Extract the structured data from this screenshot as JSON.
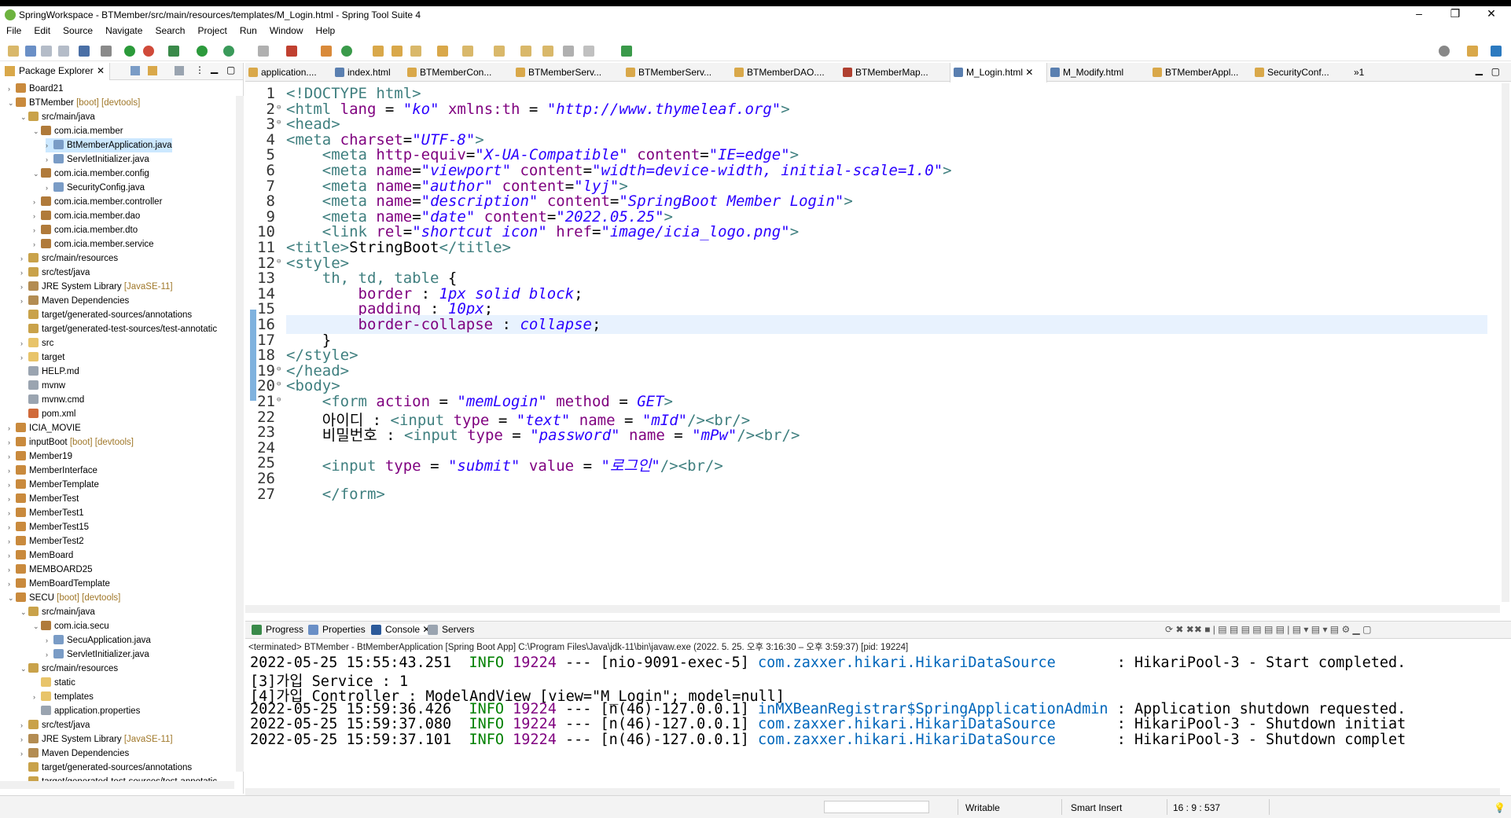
{
  "window": {
    "title": "SpringWorkspace - BTMember/src/main/resources/templates/M_Login.html - Spring Tool Suite 4",
    "minimize": "–",
    "maximize": "❐",
    "close": "✕"
  },
  "menu": [
    "File",
    "Edit",
    "Source",
    "Navigate",
    "Search",
    "Project",
    "Run",
    "Window",
    "Help"
  ],
  "package_explorer": {
    "title": "Package Explorer",
    "tree": [
      {
        "label": "Board21",
        "icon": "project",
        "indent": 0,
        "twisty": ">"
      },
      {
        "label": "BTMember",
        "deco": "[boot] [devtools]",
        "icon": "project",
        "indent": 0,
        "twisty": "v"
      },
      {
        "label": "src/main/java",
        "icon": "srcfolder",
        "indent": 1,
        "twisty": "v"
      },
      {
        "label": "com.icia.member",
        "icon": "package",
        "indent": 2,
        "twisty": "v"
      },
      {
        "label": "BtMemberApplication.java",
        "icon": "javafile",
        "indent": 3,
        "twisty": ">",
        "selected": true
      },
      {
        "label": "ServletInitializer.java",
        "icon": "javafile",
        "indent": 3,
        "twisty": ">"
      },
      {
        "label": "com.icia.member.config",
        "icon": "package",
        "indent": 2,
        "twisty": "v"
      },
      {
        "label": "SecurityConfig.java",
        "icon": "javafile",
        "indent": 3,
        "twisty": ">"
      },
      {
        "label": "com.icia.member.controller",
        "icon": "package",
        "indent": 2,
        "twisty": ">"
      },
      {
        "label": "com.icia.member.dao",
        "icon": "package",
        "indent": 2,
        "twisty": ">"
      },
      {
        "label": "com.icia.member.dto",
        "icon": "package",
        "indent": 2,
        "twisty": ">"
      },
      {
        "label": "com.icia.member.service",
        "icon": "package",
        "indent": 2,
        "twisty": ">"
      },
      {
        "label": "src/main/resources",
        "icon": "srcfolder",
        "indent": 1,
        "twisty": ">"
      },
      {
        "label": "src/test/java",
        "icon": "srcfolder",
        "indent": 1,
        "twisty": ">"
      },
      {
        "label": "JRE System Library",
        "deco": "[JavaSE-11]",
        "icon": "library",
        "indent": 1,
        "twisty": ">"
      },
      {
        "label": "Maven Dependencies",
        "icon": "library",
        "indent": 1,
        "twisty": ">"
      },
      {
        "label": "target/generated-sources/annotations",
        "icon": "srcfolder",
        "indent": 1,
        "twisty": ""
      },
      {
        "label": "target/generated-test-sources/test-annotatic",
        "icon": "srcfolder",
        "indent": 1,
        "twisty": ""
      },
      {
        "label": "src",
        "icon": "folder",
        "indent": 1,
        "twisty": ">"
      },
      {
        "label": "target",
        "icon": "folder",
        "indent": 1,
        "twisty": ">"
      },
      {
        "label": "HELP.md",
        "icon": "file",
        "indent": 1,
        "twisty": ""
      },
      {
        "label": "mvnw",
        "icon": "file",
        "indent": 1,
        "twisty": ""
      },
      {
        "label": "mvnw.cmd",
        "icon": "file",
        "indent": 1,
        "twisty": ""
      },
      {
        "label": "pom.xml",
        "icon": "xmlfile",
        "indent": 1,
        "twisty": ""
      },
      {
        "label": "ICIA_MOVIE",
        "icon": "project",
        "indent": 0,
        "twisty": ">"
      },
      {
        "label": "inputBoot",
        "deco": "[boot] [devtools]",
        "icon": "project",
        "indent": 0,
        "twisty": ">"
      },
      {
        "label": "Member19",
        "icon": "project",
        "indent": 0,
        "twisty": ">"
      },
      {
        "label": "MemberInterface",
        "icon": "project",
        "indent": 0,
        "twisty": ">"
      },
      {
        "label": "MemberTemplate",
        "icon": "project",
        "indent": 0,
        "twisty": ">"
      },
      {
        "label": "MemberTest",
        "icon": "project",
        "indent": 0,
        "twisty": ">"
      },
      {
        "label": "MemberTest1",
        "icon": "project",
        "indent": 0,
        "twisty": ">"
      },
      {
        "label": "MemberTest15",
        "icon": "project",
        "indent": 0,
        "twisty": ">"
      },
      {
        "label": "MemberTest2",
        "icon": "project",
        "indent": 0,
        "twisty": ">"
      },
      {
        "label": "MemBoard",
        "icon": "project",
        "indent": 0,
        "twisty": ">"
      },
      {
        "label": "MEMBOARD25",
        "icon": "project",
        "indent": 0,
        "twisty": ">"
      },
      {
        "label": "MemBoardTemplate",
        "icon": "project",
        "indent": 0,
        "twisty": ">"
      },
      {
        "label": "SECU",
        "deco": "[boot] [devtools]",
        "icon": "project",
        "indent": 0,
        "twisty": "v"
      },
      {
        "label": "src/main/java",
        "icon": "srcfolder",
        "indent": 1,
        "twisty": "v"
      },
      {
        "label": "com.icia.secu",
        "icon": "package",
        "indent": 2,
        "twisty": "v"
      },
      {
        "label": "SecuApplication.java",
        "icon": "javafile",
        "indent": 3,
        "twisty": ">"
      },
      {
        "label": "ServletInitializer.java",
        "icon": "javafile",
        "indent": 3,
        "twisty": ">"
      },
      {
        "label": "src/main/resources",
        "icon": "srcfolder",
        "indent": 1,
        "twisty": "v"
      },
      {
        "label": "static",
        "icon": "folder",
        "indent": 2,
        "twisty": ""
      },
      {
        "label": "templates",
        "icon": "folder",
        "indent": 2,
        "twisty": ">"
      },
      {
        "label": "application.properties",
        "icon": "file",
        "indent": 2,
        "twisty": ""
      },
      {
        "label": "src/test/java",
        "icon": "srcfolder",
        "indent": 1,
        "twisty": ">"
      },
      {
        "label": "JRE System Library",
        "deco": "[JavaSE-11]",
        "icon": "library",
        "indent": 1,
        "twisty": ">"
      },
      {
        "label": "Maven Dependencies",
        "icon": "library",
        "indent": 1,
        "twisty": ">"
      },
      {
        "label": "target/generated-sources/annotations",
        "icon": "srcfolder",
        "indent": 1,
        "twisty": ""
      },
      {
        "label": "target/generated-test-sources/test-annotatic",
        "icon": "srcfolder",
        "indent": 1,
        "twisty": ""
      }
    ]
  },
  "editor_tabs": [
    {
      "label": "application....",
      "icon": "properties"
    },
    {
      "label": "index.html",
      "icon": "html"
    },
    {
      "label": "BTMemberCon...",
      "icon": "java"
    },
    {
      "label": "BTMemberServ...",
      "icon": "java"
    },
    {
      "label": "BTMemberServ...",
      "icon": "java"
    },
    {
      "label": "BTMemberDAO....",
      "icon": "java"
    },
    {
      "label": "BTMemberMap...",
      "icon": "xml"
    },
    {
      "label": "M_Login.html",
      "icon": "html",
      "active": true
    },
    {
      "label": "M_Modify.html",
      "icon": "html"
    },
    {
      "label": "BTMemberAppl...",
      "icon": "java"
    },
    {
      "label": "SecurityConf...",
      "icon": "java"
    },
    {
      "label": "»1",
      "icon": ""
    }
  ],
  "code_lines": [
    {
      "n": "1",
      "html": "<span class='tg'>&lt;!DOCTYPE html&gt;</span>"
    },
    {
      "n": "2",
      "fold": "⊖",
      "html": "<span class='tg'>&lt;html</span> <span class='at'>lang</span> = <span class='av'>\"ko\"</span> <span class='at'>xmlns:th</span> = <span class='av'>\"http://www.thymeleaf.org\"</span><span class='tg'>&gt;</span>"
    },
    {
      "n": "3",
      "fold": "⊖",
      "html": "<span class='tg'>&lt;head&gt;</span>"
    },
    {
      "n": "4",
      "html": "<span class='tg'>&lt;meta</span> <span class='at'>charset</span>=<span class='av'>\"UTF-8\"</span><span class='tg'>&gt;</span>"
    },
    {
      "n": "5",
      "html": "    <span class='tg'>&lt;meta</span> <span class='at'>http-equiv</span>=<span class='av'>\"X-UA-Compatible\"</span> <span class='at'>content</span>=<span class='av'>\"IE=edge\"</span><span class='tg'>&gt;</span>"
    },
    {
      "n": "6",
      "html": "    <span class='tg'>&lt;meta</span> <span class='at'>name</span>=<span class='av'>\"viewport\"</span> <span class='at'>content</span>=<span class='av'>\"width=device-width, initial-scale=1.0\"</span><span class='tg'>&gt;</span>"
    },
    {
      "n": "7",
      "html": "    <span class='tg'>&lt;meta</span> <span class='at'>name</span>=<span class='av'>\"author\"</span> <span class='at'>content</span>=<span class='av'>\"lyj\"</span><span class='tg'>&gt;</span>"
    },
    {
      "n": "8",
      "html": "    <span class='tg'>&lt;meta</span> <span class='at'>name</span>=<span class='av'>\"description\"</span> <span class='at'>content</span>=<span class='av'>\"SpringBoot Member Login\"</span><span class='tg'>&gt;</span>"
    },
    {
      "n": "9",
      "html": "    <span class='tg'>&lt;meta</span> <span class='at'>name</span>=<span class='av'>\"date\"</span> <span class='at'>content</span>=<span class='av'>\"2022.05.25\"</span><span class='tg'>&gt;</span>"
    },
    {
      "n": "10",
      "html": "    <span class='tg'>&lt;link</span> <span class='at'>rel</span>=<span class='av'>\"shortcut icon\"</span> <span class='at'>href</span>=<span class='av'>\"image/icia_logo.png\"</span><span class='tg'>&gt;</span>"
    },
    {
      "n": "11",
      "html": "<span class='tg'>&lt;title&gt;</span>StringBoot<span class='tg'>&lt;/title&gt;</span>"
    },
    {
      "n": "12",
      "fold": "⊖",
      "html": "<span class='tg'>&lt;style&gt;</span>"
    },
    {
      "n": "13",
      "html": "    <span class='tg'>th, td, table</span> {"
    },
    {
      "n": "14",
      "html": "        <span class='at'>border</span> : <span class='cv'>1px solid block</span>;"
    },
    {
      "n": "15",
      "html": "        <span class='at'>padding</span> : <span class='cv'>10px</span>;"
    },
    {
      "n": "16",
      "html": "        <span class='at'>border-collapse</span> : <span class='cv'>collapse</span>;",
      "current": true
    },
    {
      "n": "17",
      "html": "    }"
    },
    {
      "n": "18",
      "html": "<span class='tg'>&lt;/style&gt;</span>"
    },
    {
      "n": "19",
      "fold": "⊖",
      "html": "<span class='tg'>&lt;/head&gt;</span>"
    },
    {
      "n": "20",
      "fold": "⊖",
      "html": "<span class='tg'>&lt;body&gt;</span>"
    },
    {
      "n": "21",
      "fold": "⊖",
      "html": "    <span class='tg'>&lt;form</span> <span class='at'>action</span> = <span class='av'>\"memLogin\"</span> <span class='at'>method</span> = <span class='av'>GET</span><span class='tg'>&gt;</span>"
    },
    {
      "n": "22",
      "html": "    아이디 : <span class='tg'>&lt;input</span> <span class='at'>type</span> = <span class='av'>\"text\"</span> <span class='at'>name</span> = <span class='av'>\"mId\"</span><span class='tg'>/&gt;&lt;br/&gt;</span>"
    },
    {
      "n": "23",
      "html": "    비밀번호 : <span class='tg'>&lt;input</span> <span class='at'>type</span> = <span class='av'>\"password\"</span> <span class='at'>name</span> = <span class='av'>\"mPw\"</span><span class='tg'>/&gt;&lt;br/&gt;</span>"
    },
    {
      "n": "24",
      "html": ""
    },
    {
      "n": "25",
      "html": "    <span class='tg'>&lt;input</span> <span class='at'>type</span> = <span class='av'>\"submit\"</span> <span class='at'>value</span> = <span class='av'>\"로그인\"</span><span class='tg'>/&gt;&lt;br/&gt;</span>"
    },
    {
      "n": "26",
      "html": ""
    },
    {
      "n": "27",
      "html": "    <span class='tg'>&lt;/form&gt;</span>"
    }
  ],
  "console": {
    "tabs": [
      {
        "label": "Progress"
      },
      {
        "label": "Properties"
      },
      {
        "label": "Console",
        "active": true
      },
      {
        "label": "Servers"
      }
    ],
    "terminated": "<terminated> BTMember - BtMemberApplication [Spring Boot App] C:\\Program Files\\Java\\jdk-11\\bin\\javaw.exe  (2022. 5. 25. 오후 3:16:30 – 오후 3:59:37) [pid: 19224]",
    "lines": [
      {
        "html": "2022-05-25 15:55:43.251  <span class='info'>INFO</span> <span class='pid'>19224</span> --- [nio-9091-exec-5] <span class='cls'>com.zaxxer.hikari.HikariDataSource      </span> : HikariPool-3 - Start completed."
      },
      {
        "html": "[3]가입 Service : 1"
      },
      {
        "html": "[4]가입 Controller : ModelAndView [view=\"M_Login\"; model=null]"
      },
      {
        "html": "2022-05-25 15:59:36.426  <span class='info'>INFO</span> <span class='pid'>19224</span> --- [n(46)-127.0.0.1] <span class='cls'>inMXBeanRegistrar$SpringApplicationAdmin</span> : Application shutdown requested."
      },
      {
        "html": "2022-05-25 15:59:37.080  <span class='info'>INFO</span> <span class='pid'>19224</span> --- [n(46)-127.0.0.1] <span class='cls'>com.zaxxer.hikari.HikariDataSource      </span> : HikariPool-3 - Shutdown initiat"
      },
      {
        "html": "2022-05-25 15:59:37.101  <span class='info'>INFO</span> <span class='pid'>19224</span> --- [n(46)-127.0.0.1] <span class='cls'>com.zaxxer.hikari.HikariDataSource      </span> : HikariPool-3 - Shutdown complet"
      }
    ]
  },
  "status": {
    "writable": "Writable",
    "insert_mode": "Smart Insert",
    "position": "16 : 9 : 537"
  },
  "colors": {
    "project": "#c98a3d",
    "srcfolder": "#c9a24a",
    "package": "#b07a3a",
    "javafile": "#7a9cc6",
    "folder": "#e8c46a",
    "library": "#b38c52",
    "file": "#9aa4b0",
    "xmlfile": "#d06a3a"
  }
}
